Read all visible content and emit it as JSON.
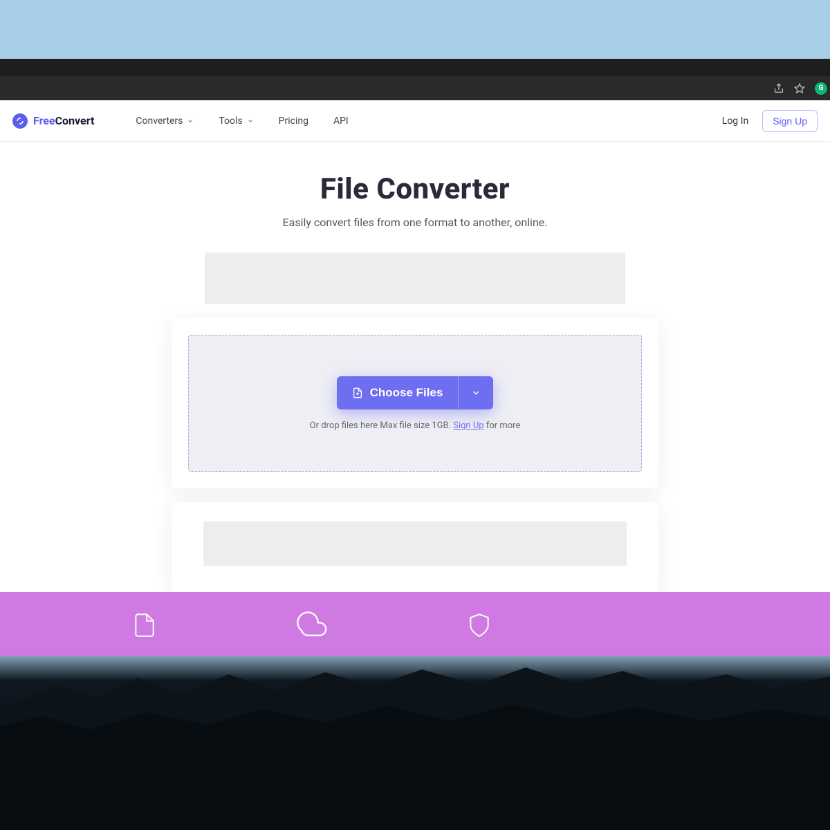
{
  "browser": {
    "ext_badge": "G"
  },
  "brand": {
    "prefix": "Free",
    "suffix": "Convert"
  },
  "nav": {
    "items": [
      {
        "label": "Converters",
        "has_dropdown": true
      },
      {
        "label": "Tools",
        "has_dropdown": true
      },
      {
        "label": "Pricing",
        "has_dropdown": false
      },
      {
        "label": "API",
        "has_dropdown": false
      }
    ],
    "login": "Log In",
    "signup": "Sign Up"
  },
  "hero": {
    "title": "File Converter",
    "subtitle": "Easily convert files from one format to another, online."
  },
  "upload": {
    "button": "Choose Files",
    "hint_prefix": "Or drop files here Max file size 1GB. ",
    "hint_link": "Sign Up",
    "hint_suffix": " for more"
  },
  "colors": {
    "accent": "#5b5ef0",
    "button": "#6e6ef0",
    "band": "#cf7ae3"
  }
}
